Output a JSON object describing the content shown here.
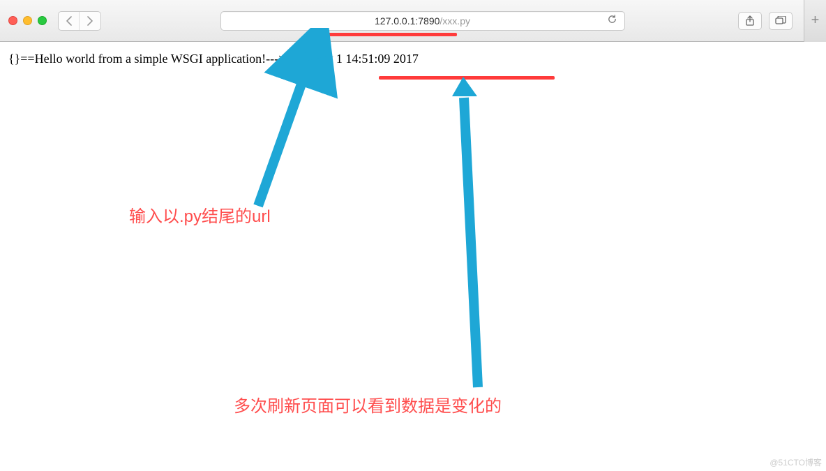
{
  "browser": {
    "url_host": "127.0.0.1:7890",
    "url_path": "/xxx.py"
  },
  "page": {
    "body_text": "{}==Hello world from a simple WSGI application!--->Wed Nov 1 14:51:09 2017"
  },
  "annotations": {
    "label_url": "输入以.py结尾的url",
    "label_refresh": "多次刷新页面可以看到数据是变化的"
  },
  "watermark": "@51CTO博客"
}
